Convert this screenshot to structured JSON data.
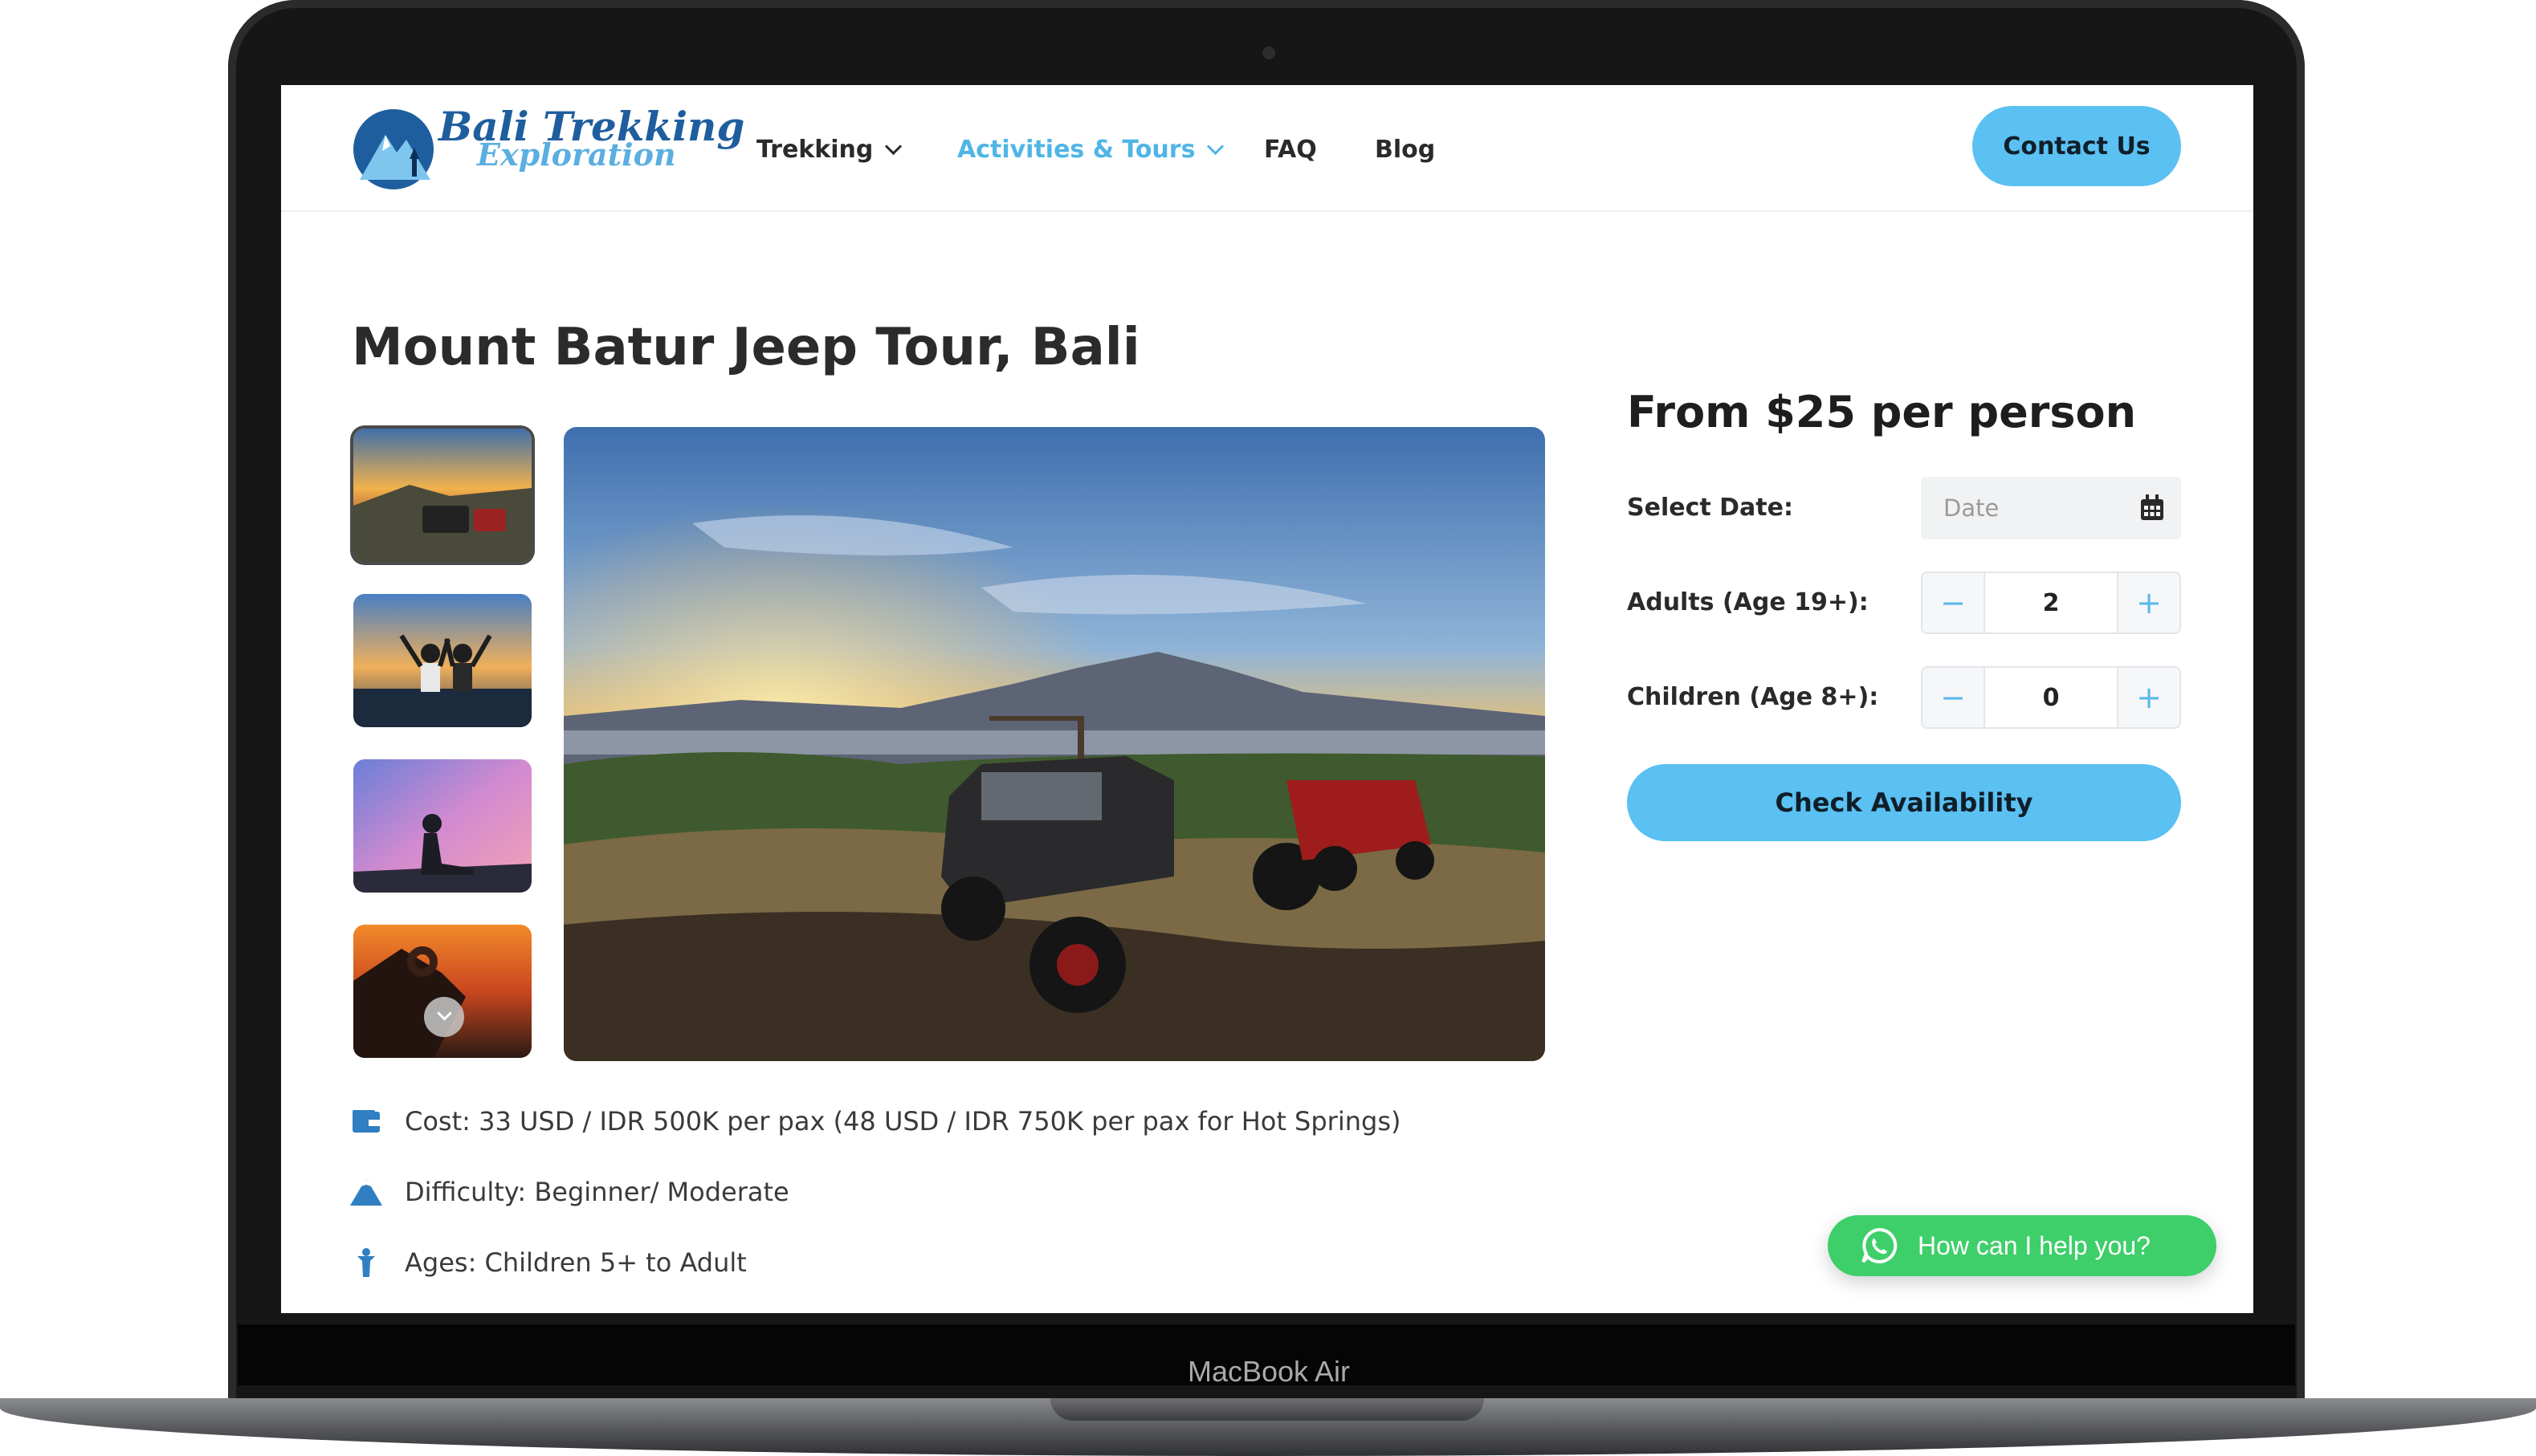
{
  "device": {
    "label": "MacBook Air"
  },
  "header": {
    "logo_title": "Bali Trekking",
    "logo_subtitle": "Exploration",
    "nav": [
      {
        "label": "Trekking",
        "has_dropdown": true,
        "active": false
      },
      {
        "label": "Activities & Tours",
        "has_dropdown": true,
        "active": true
      },
      {
        "label": "FAQ",
        "has_dropdown": false,
        "active": false
      },
      {
        "label": "Blog",
        "has_dropdown": false,
        "active": false
      }
    ],
    "contact_label": "Contact Us"
  },
  "tour": {
    "title": "Mount Batur Jeep Tour, Bali",
    "gallery": {
      "thumbnails": [
        "sunrise-jeeps",
        "couple-sunrise",
        "sitting-silhouette",
        "heart-hands-sunset"
      ],
      "selected_index": 0,
      "main_image": "jeeps-at-sunrise-mount-batur"
    },
    "info": [
      {
        "icon": "wallet-icon",
        "text": "Cost: 33 USD / IDR 500K per pax (48 USD / IDR 750K per pax for Hot Springs)"
      },
      {
        "icon": "mountain-icon",
        "text": "Difficulty: Beginner/ Moderate"
      },
      {
        "icon": "person-icon",
        "text": "Ages: Children 5+ to Adult"
      }
    ]
  },
  "booking": {
    "price_text": "From $25 per person",
    "date_label": "Select Date:",
    "date_placeholder": "Date",
    "adults_label": "Adults (Age 19+):",
    "adults_value": "2",
    "children_label": "Children (Age 8+):",
    "children_value": "0",
    "minus_symbol": "−",
    "plus_symbol": "+",
    "check_label": "Check Availability"
  },
  "chat": {
    "label": "How can I help you?"
  },
  "colors": {
    "accent": "#5bc0f2",
    "nav_active": "#4fb5e6",
    "logo_blue": "#1f5e9e",
    "whatsapp_green": "#3ecf6a"
  }
}
